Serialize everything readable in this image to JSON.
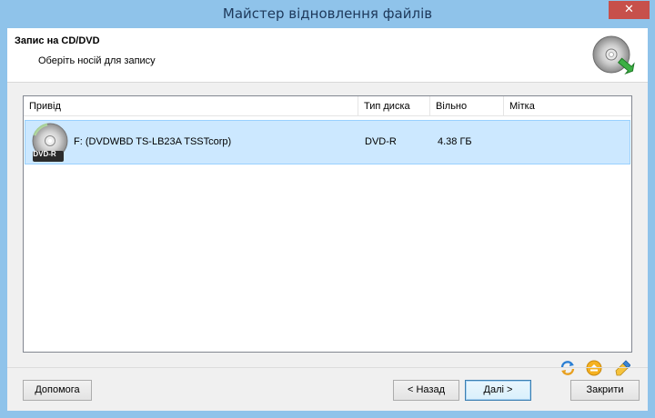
{
  "window": {
    "title": "Майстер відновлення файлів",
    "close_label": "✕"
  },
  "header": {
    "title": "Запис на CD/DVD",
    "subtitle": "Оберіть носій для запису",
    "icon": "cd-burn-icon"
  },
  "listview": {
    "columns": [
      "Привід",
      "Тип диска",
      "Вільно",
      "Мітка"
    ],
    "rows": [
      {
        "drive": "F: (DVDWBD TS-LB23A TSSTcorp)",
        "type": "DVD-R",
        "free": "4.38 ГБ",
        "label": "",
        "badge": "DVD-R",
        "icon": "dvd-disc-icon"
      }
    ]
  },
  "actions": {
    "refresh_icon": "refresh-icon",
    "eject_icon": "eject-icon",
    "erase_icon": "erase-icon"
  },
  "buttons": {
    "help": "Допомога",
    "back": "< Назад",
    "next": "Далі >",
    "close": "Закрити"
  },
  "colors": {
    "frame": "#8fc3ea",
    "selection": "#cce8ff",
    "close": "#c7504b"
  }
}
